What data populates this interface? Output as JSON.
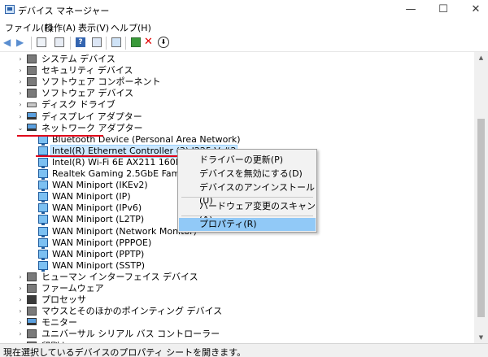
{
  "window": {
    "title": "デバイス マネージャー",
    "minimize_glyph": "—",
    "maximize_glyph": "☐",
    "close_glyph": "✕"
  },
  "menu": [
    "ファイル(F)",
    "操作(A)",
    "表示(V)",
    "ヘルプ(H)"
  ],
  "toolbar": {
    "back_glyph": "◀",
    "forward_glyph": "▶",
    "help_glyph": "?",
    "uninstall_glyph": "✕",
    "update_glyph": "⬇",
    "accent": "#e00000"
  },
  "tree": {
    "categories_top": [
      {
        "label": "システム デバイス",
        "icon": "system-device-icon"
      },
      {
        "label": "セキュリティ デバイス",
        "icon": "security-device-icon"
      },
      {
        "label": "ソフトウェア コンポーネント",
        "icon": "software-component-icon"
      },
      {
        "label": "ソフトウェア デバイス",
        "icon": "software-device-icon"
      },
      {
        "label": "ディスク ドライブ",
        "icon": "disk-drive-icon"
      },
      {
        "label": "ディスプレイ アダプター",
        "icon": "display-adapter-icon"
      }
    ],
    "network": {
      "label": "ネットワーク アダプター",
      "icon": "network-adapter-icon",
      "expanded_glyph": "⌄",
      "collapsed_glyph": "›",
      "children": [
        "Bluetooth Device (Personal Area Network)",
        "Intel(R) Ethernet Controller (3) I225-V #2",
        "Intel(R) Wi-Fi 6E AX211 160MHz",
        "Realtek Gaming 2.5GbE Family Controll",
        "WAN Miniport (IKEv2)",
        "WAN Miniport (IP)",
        "WAN Miniport (IPv6)",
        "WAN Miniport (L2TP)",
        "WAN Miniport (Network Monitor)",
        "WAN Miniport (PPPOE)",
        "WAN Miniport (PPTP)",
        "WAN Miniport (SSTP)"
      ],
      "selected_index": 1
    },
    "categories_bottom": [
      {
        "label": "ヒューマン インターフェイス デバイス",
        "icon": "hid-icon"
      },
      {
        "label": "ファームウェア",
        "icon": "firmware-icon"
      },
      {
        "label": "プロセッサ",
        "icon": "processor-icon"
      },
      {
        "label": "マウスとそのほかのポインティング デバイス",
        "icon": "mouse-icon"
      },
      {
        "label": "モニター",
        "icon": "monitor-icon"
      },
      {
        "label": "ユニバーサル シリアル バス コントローラー",
        "icon": "usb-controller-icon"
      },
      {
        "label": "印刷キュー",
        "icon": "print-queue-icon"
      }
    ]
  },
  "context_menu": {
    "update_driver": "ドライバーの更新(P)",
    "disable_device": "デバイスを無効にする(D)",
    "uninstall_device": "デバイスのアンインストール(U)",
    "scan_hardware": "ハードウェア変更のスキャン(A)",
    "properties": "プロパティ(R)"
  },
  "status_bar": "現在選択しているデバイスのプロパティ シートを開きます。",
  "colors": {
    "highlight_underline": "#e0001a",
    "selection": "#cce8ff",
    "menu_highlight": "#91c9f7"
  }
}
